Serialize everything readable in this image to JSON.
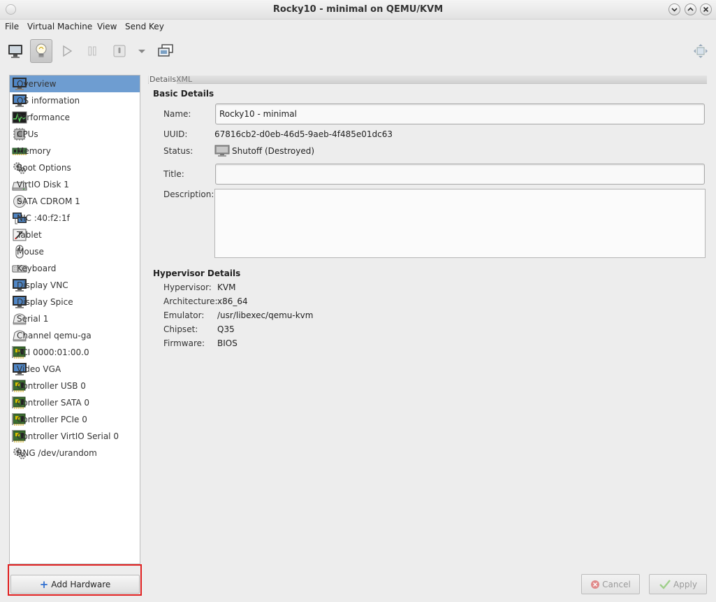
{
  "window": {
    "title": "Rocky10 - minimal on QEMU/KVM"
  },
  "menu": [
    "File",
    "Virtual Machine",
    "View",
    "Send Key"
  ],
  "toolbar": {
    "buttons": [
      "console-icon",
      "details-lightbulb-icon",
      "run-icon",
      "pause-icon",
      "shutdown-icon",
      "shutdown-dropdown-icon",
      "snapshots-icon"
    ],
    "fullscreen_icon": "fullscreen-icon"
  },
  "sidebar": {
    "selected_color": "#6e9dd1",
    "items": [
      {
        "label": "Overview",
        "icon": "monitor-icon"
      },
      {
        "label": "OS information",
        "icon": "monitor-icon"
      },
      {
        "label": "Performance",
        "icon": "performance-chart-icon"
      },
      {
        "label": "CPUs",
        "icon": "cpu-chip-icon"
      },
      {
        "label": "Memory",
        "icon": "memory-icon"
      },
      {
        "label": "Boot Options",
        "icon": "gears-icon"
      },
      {
        "label": "VirtIO Disk 1",
        "icon": "hard-disk-icon"
      },
      {
        "label": "SATA CDROM 1",
        "icon": "cdrom-icon"
      },
      {
        "label": "NIC :40:f2:1f",
        "icon": "network-icon"
      },
      {
        "label": "Tablet",
        "icon": "tablet-icon"
      },
      {
        "label": "Mouse",
        "icon": "mouse-icon"
      },
      {
        "label": "Keyboard",
        "icon": "keyboard-icon"
      },
      {
        "label": "Display VNC",
        "icon": "monitor-icon"
      },
      {
        "label": "Display Spice",
        "icon": "monitor-icon"
      },
      {
        "label": "Serial 1",
        "icon": "serial-icon"
      },
      {
        "label": "Channel qemu-ga",
        "icon": "serial-icon"
      },
      {
        "label": "PCI 0000:01:00.0",
        "icon": "pci-card-icon"
      },
      {
        "label": "Video VGA",
        "icon": "monitor-icon"
      },
      {
        "label": "Controller USB 0",
        "icon": "pci-card-icon"
      },
      {
        "label": "Controller SATA 0",
        "icon": "pci-card-icon"
      },
      {
        "label": "Controller PCIe 0",
        "icon": "pci-card-icon"
      },
      {
        "label": "Controller VirtIO Serial 0",
        "icon": "pci-card-icon"
      },
      {
        "label": "RNG /dev/urandom",
        "icon": "gears-icon"
      }
    ],
    "add_hardware_label": "Add Hardware"
  },
  "tabs": [
    {
      "label": "Details",
      "active": true
    },
    {
      "label": "XML",
      "active": false
    }
  ],
  "basic": {
    "heading": "Basic Details",
    "name_label": "Name:",
    "name_value": "Rocky10 - minimal",
    "uuid_label": "UUID:",
    "uuid_value": "67816cb2-d0eb-46d5-9aeb-4f485e01dc63",
    "status_label": "Status:",
    "status_value": "Shutoff (Destroyed)",
    "title_label": "Title:",
    "title_value": "",
    "description_label": "Description:",
    "description_value": ""
  },
  "hypervisor": {
    "heading": "Hypervisor Details",
    "rows": [
      {
        "label": "Hypervisor:",
        "value": "KVM"
      },
      {
        "label": "Architecture:",
        "value": "x86_64"
      },
      {
        "label": "Emulator:",
        "value": "/usr/libexec/qemu-kvm"
      },
      {
        "label": "Chipset:",
        "value": "Q35"
      },
      {
        "label": "Firmware:",
        "value": "BIOS"
      }
    ]
  },
  "buttons": {
    "cancel": "Cancel",
    "apply": "Apply"
  }
}
